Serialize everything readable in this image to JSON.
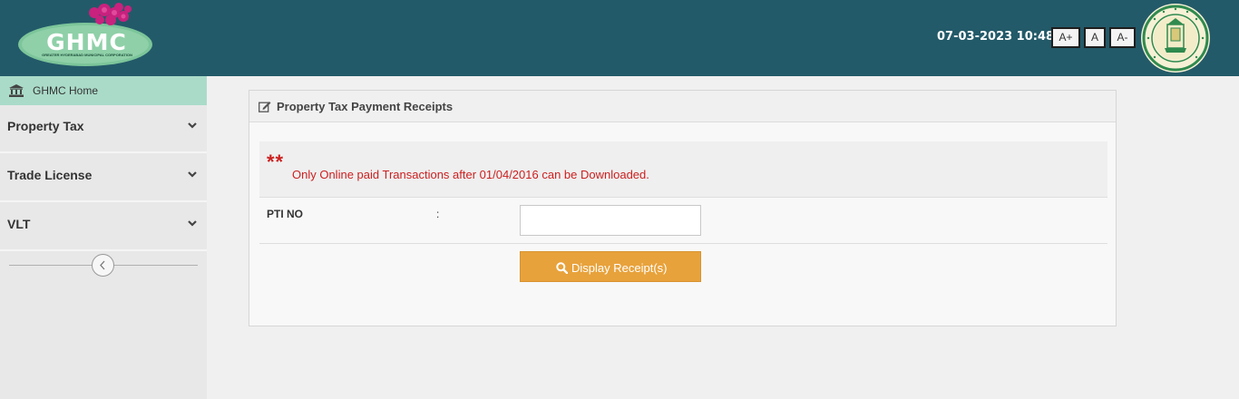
{
  "header": {
    "logo_text": "GHMC",
    "logo_subtitle": "GREATER HYDERABAD MUNICIPAL CORPORATION",
    "datetime": "07-03-2023 10:48:33",
    "font_buttons": [
      "A+",
      "A",
      "A-"
    ],
    "bg_color": "#235a69"
  },
  "sidebar": {
    "home_label": "GHMC Home",
    "items": [
      {
        "label": "Property Tax",
        "icon": "chevron-down-icon"
      },
      {
        "label": "Trade License",
        "icon": "chevron-down-icon"
      },
      {
        "label": "VLT",
        "icon": "chevron-down-icon"
      }
    ],
    "home_color": "#aadbc9"
  },
  "panel": {
    "title": "Property Tax Payment Receipts",
    "notice_stars": "**",
    "notice_text": "Only Online paid Transactions after 01/04/2016 can be Downloaded.",
    "pti_label": "PTI NO",
    "pti_colon": ":",
    "pti_value": "",
    "button_label": "Display Receipt(s)",
    "button_color": "#e8a23b",
    "notice_color": "#cc1f1f"
  }
}
